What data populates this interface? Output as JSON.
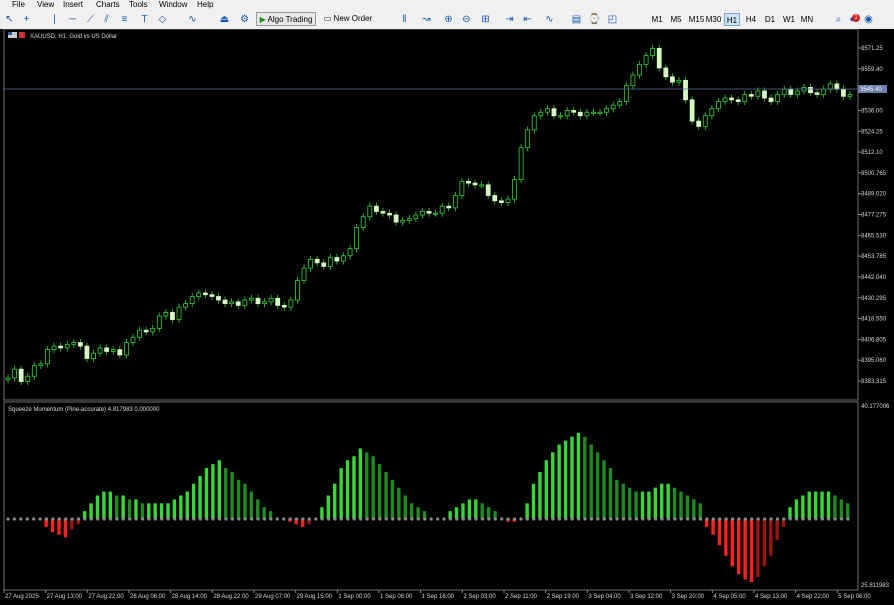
{
  "menu": [
    "File",
    "View",
    "Insert",
    "Charts",
    "Tools",
    "Window",
    "Help"
  ],
  "toolbar": {
    "algo_trading": "Algo Trading",
    "new_order": "New Order",
    "timeframes": [
      "M1",
      "M5",
      "M15",
      "M30",
      "H1",
      "H4",
      "D1",
      "W1",
      "MN"
    ],
    "active_timeframe": "H1",
    "notification_count": "1",
    "icons": [
      "cursor-icon",
      "crosshair-icon",
      "vertical-line-icon",
      "horizontal-line-icon",
      "trendline-icon",
      "channel-icon",
      "fibonacci-icon",
      "text-icon",
      "shapes-icon",
      "indicator-icon",
      "alert-icon",
      "settings-icon",
      "bars-icon",
      "candles-icon",
      "line-chart-icon",
      "zoom-in-icon",
      "zoom-out-icon",
      "grid-icon",
      "autoscroll-icon",
      "chart-shift-icon",
      "indicators-icon",
      "templates-icon",
      "periods-icon",
      "objects-icon",
      "search-icon",
      "notification-icon",
      "profile-icon"
    ]
  },
  "chart": {
    "title": "XAUUSD, H1:  Gold vs US Dollar",
    "current_price": "3545.40",
    "price_ticks": [
      "3571.25",
      "3559.40",
      "3547.70",
      "3536.00",
      "3524.25",
      "3512.10",
      "3500.765",
      "3489.020",
      "3477.275",
      "3465.530",
      "3453.785",
      "3442.040",
      "3430.295",
      "3418.550",
      "3406.805",
      "3395.060",
      "3383.315"
    ],
    "indicator_label": "Squeeze Momentum (Pine-accurate) 4.817983 0.000000",
    "indicator_ticks": [
      "40.177006",
      "25.811983"
    ],
    "time_labels": [
      "27 Aug 2025",
      "27 Aug 13:00",
      "27 Aug 22:00",
      "28 Aug 06:00",
      "28 Aug 14:00",
      "28 Aug 22:00",
      "29 Aug 07:00",
      "29 Aug 15:00",
      "1 Sep 00:00",
      "1 Sep 08:00",
      "1 Sep 16:00",
      "2 Sep 03:00",
      "2 Sep 11:00",
      "2 Sep 19:00",
      "3 Sep 04:00",
      "3 Sep 12:00",
      "3 Sep 20:00",
      "4 Sep 05:00",
      "4 Sep 13:00",
      "4 Sep 22:00",
      "5 Sep 06:00"
    ]
  },
  "chart_data": {
    "type": "candlestick",
    "price_axis": {
      "min": 3383.315,
      "max": 3571.25
    },
    "close": [
      3385,
      3390,
      3383,
      3386,
      3392,
      3393,
      3401,
      3403,
      3402,
      3404,
      3405,
      3403,
      3396,
      3399,
      3402,
      3400,
      3401,
      3398,
      3405,
      3408,
      3412,
      3411,
      3413,
      3420,
      3422,
      3418,
      3425,
      3427,
      3431,
      3433,
      3432,
      3431,
      3429,
      3427,
      3428,
      3426,
      3429,
      3430,
      3427,
      3428,
      3430,
      3426,
      3425,
      3429,
      3440,
      3447,
      3452,
      3450,
      3448,
      3453,
      3451,
      3454,
      3458,
      3470,
      3476,
      3482,
      3479,
      3478,
      3477,
      3473,
      3474,
      3475,
      3477,
      3479,
      3478,
      3478,
      3482,
      3481,
      3488,
      3496,
      3495,
      3494,
      3494,
      3488,
      3485,
      3484,
      3486,
      3497,
      3515,
      3525,
      3533,
      3535,
      3537,
      3533,
      3533,
      3536,
      3535,
      3533,
      3535,
      3535,
      3535,
      3537,
      3539,
      3541,
      3550,
      3556,
      3562,
      3567,
      3571,
      3560,
      3555,
      3552,
      3553,
      3542,
      3530,
      3527,
      3533,
      3537,
      3541,
      3543,
      3542,
      3541,
      3545,
      3544,
      3547,
      3543,
      3541,
      3545,
      3548,
      3545,
      3547,
      3549,
      3546,
      3545,
      3548,
      3551,
      3548,
      3544,
      3545
    ],
    "momentum": [
      0,
      0,
      0,
      0,
      0,
      0,
      -3,
      -5,
      -6,
      -7,
      -4,
      -2,
      2,
      4,
      6,
      7,
      7,
      6,
      6,
      5,
      5,
      4,
      4,
      4,
      4,
      4,
      5,
      6,
      7,
      9,
      11,
      13,
      14,
      15,
      13,
      12,
      10,
      9,
      7,
      5,
      3,
      2,
      0,
      0,
      -1,
      -2,
      -3,
      -2,
      0,
      3,
      6,
      9,
      13,
      15,
      16,
      18,
      17,
      16,
      14,
      12,
      10,
      8,
      6,
      4,
      3,
      2,
      0,
      0,
      0,
      2,
      3,
      4,
      5,
      5,
      4,
      3,
      2,
      0,
      -1,
      -1,
      0,
      4,
      9,
      12,
      15,
      17,
      19,
      20,
      21,
      22,
      21,
      19,
      17,
      15,
      13,
      10,
      9,
      8,
      7,
      7,
      7,
      8,
      9,
      9,
      8,
      7,
      6,
      5,
      4,
      -3,
      -6,
      -10,
      -14,
      -18,
      -21,
      -23,
      -24,
      -22,
      -18,
      -14,
      -8,
      -3,
      3,
      5,
      6,
      7,
      7,
      7,
      7,
      6,
      5,
      4
    ]
  }
}
